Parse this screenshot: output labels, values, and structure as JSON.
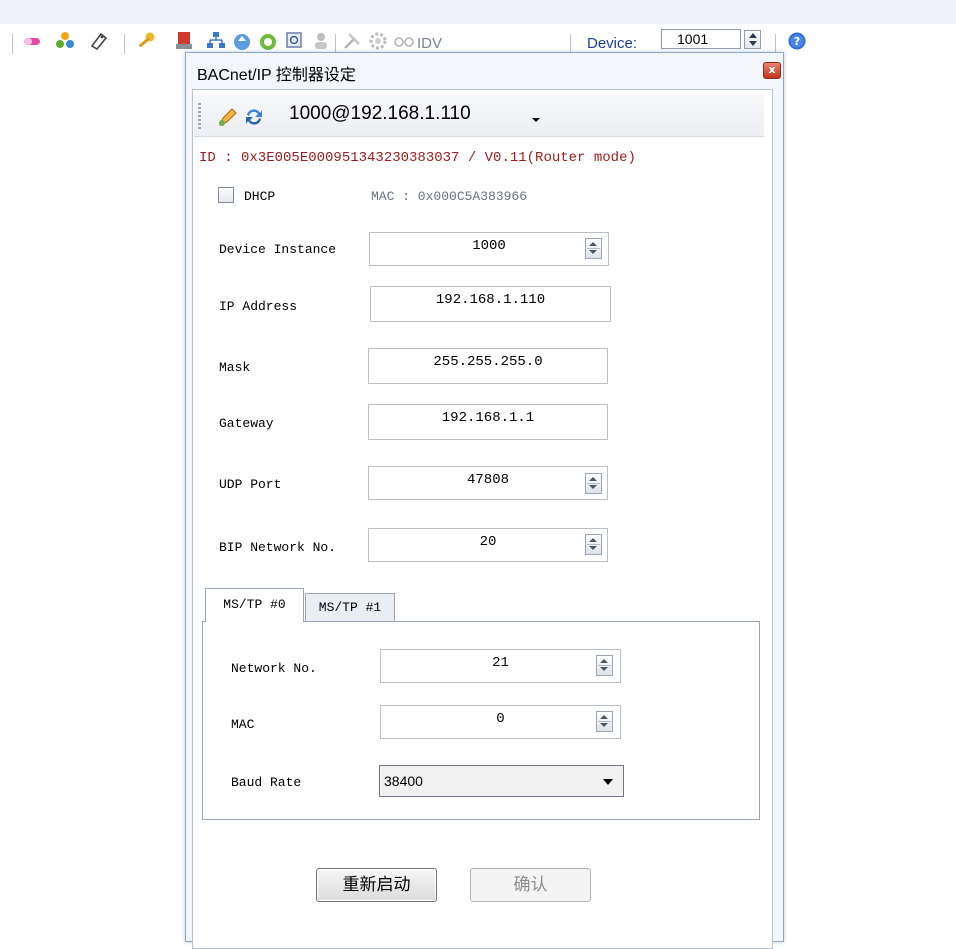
{
  "toolbar": {
    "fragment_text": "IDV",
    "device_label": "Device:",
    "device_value": "1001"
  },
  "dialog": {
    "title": "BACnet/IP 控制器设定",
    "close_label": "x",
    "connection": "1000@192.168.1.110",
    "id_line": "ID : 0x3E005E000951343230383037  / V0.11(Router mode)",
    "dhcp_label": "DHCP",
    "dhcp_checked": false,
    "mac_info": "MAC : 0x000C5A383966",
    "fields": {
      "device_instance": {
        "label": "Device Instance",
        "value": "1000"
      },
      "ip_address": {
        "label": "IP Address",
        "value": "192.168.1.110"
      },
      "mask": {
        "label": "Mask",
        "value": "255.255.255.0"
      },
      "gateway": {
        "label": "Gateway",
        "value": "192.168.1.1"
      },
      "udp_port": {
        "label": "UDP Port",
        "value": "47808"
      },
      "bip_network": {
        "label": "BIP Network No.",
        "value": "20"
      }
    },
    "tabs": [
      {
        "label": "MS/TP #0",
        "active": true
      },
      {
        "label": "MS/TP #1",
        "active": false
      }
    ],
    "mstp": {
      "network_no": {
        "label": "Network No.",
        "value": "21"
      },
      "mac": {
        "label": "MAC",
        "value": "0"
      },
      "baud_rate": {
        "label": "Baud Rate",
        "value": "38400"
      }
    },
    "buttons": {
      "restart": "重新启动",
      "confirm": "确认"
    }
  },
  "colors": {
    "accent": "#1c3fa3",
    "id_text": "#9c1c1c",
    "dialog_border": "#8ea6c8"
  }
}
